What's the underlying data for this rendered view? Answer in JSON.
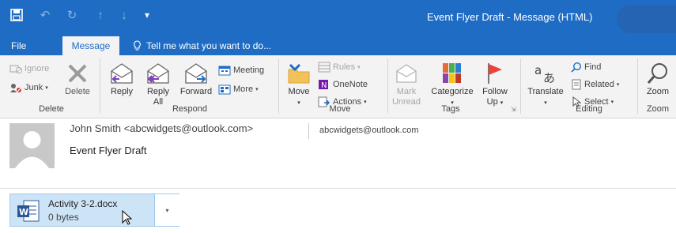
{
  "window": {
    "title": "Event Flyer Draft - Message (HTML)",
    "qat_icons": [
      "save-icon",
      "undo-icon",
      "redo-icon",
      "up-arrow-icon",
      "down-arrow-icon",
      "customize-qat-icon"
    ]
  },
  "tabs": {
    "file": "File",
    "message": "Message",
    "tell_me": "Tell me what you want to do..."
  },
  "ribbon": {
    "delete_group": {
      "label": "Delete",
      "ignore": "Ignore",
      "junk": "Junk",
      "delete": "Delete"
    },
    "respond_group": {
      "label": "Respond",
      "reply": "Reply",
      "reply_all_1": "Reply",
      "reply_all_2": "All",
      "forward": "Forward",
      "meeting": "Meeting",
      "more": "More"
    },
    "move_group": {
      "label": "Move",
      "move": "Move",
      "rules": "Rules",
      "onenote": "OneNote",
      "actions": "Actions"
    },
    "tags_group": {
      "label": "Tags",
      "mark_unread_1": "Mark",
      "mark_unread_2": "Unread",
      "categorize": "Categorize",
      "follow_up_1": "Follow",
      "follow_up_2": "Up"
    },
    "editing_group": {
      "label": "Editing",
      "translate": "Translate",
      "find": "Find",
      "related": "Related",
      "select": "Select"
    },
    "zoom_group": {
      "label": "Zoom",
      "zoom": "Zoom"
    }
  },
  "message": {
    "sender": "John Smith <abcwidgets@outlook.com>",
    "to": "abcwidgets@outlook.com",
    "subject": "Event Flyer Draft"
  },
  "attachment": {
    "name": "Activity 3-2.docx",
    "size": "0 bytes"
  },
  "colors": {
    "accent": "#1f6cc4",
    "ribbon_bg": "#f3f3f3",
    "attachment_bg": "#cde4f7",
    "flag_red": "#e8443a",
    "arrow_purple": "#7b3fb8"
  }
}
